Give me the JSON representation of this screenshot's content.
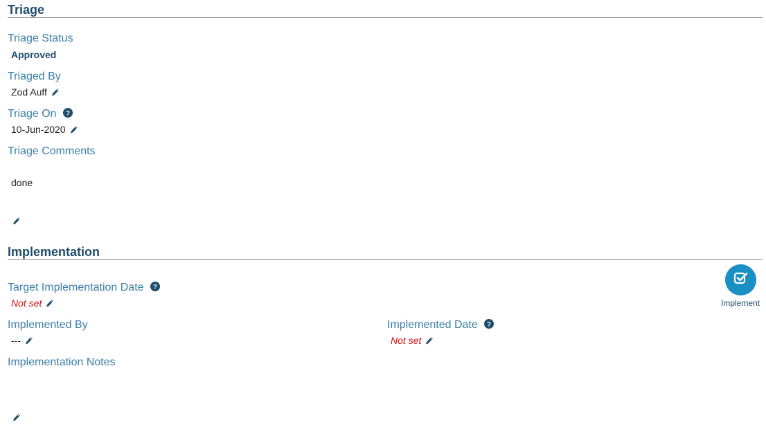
{
  "triage": {
    "title": "Triage",
    "status_label": "Triage Status",
    "status_value": "Approved",
    "by_label": "Triaged By",
    "by_value": "Zod Auff",
    "on_label": "Triage On",
    "on_value": "10-Jun-2020",
    "comments_label": "Triage Comments",
    "comments_value": "done"
  },
  "implementation": {
    "title": "Implementation",
    "target_label": "Target Implementation Date",
    "target_value": "Not set",
    "by_label": "Implemented By",
    "by_value": "---",
    "date_label": "Implemented Date",
    "date_value": "Not set",
    "notes_label": "Implementation Notes",
    "notes_value": "",
    "implement_button_label": "Implement"
  },
  "colors": {
    "heading": "#1f4e6b",
    "label": "#3a7fa8",
    "not_set": "#d01010",
    "button": "#1a8fc4"
  },
  "icons": [
    "pencil-icon",
    "help-icon",
    "checkbox-check-icon"
  ]
}
